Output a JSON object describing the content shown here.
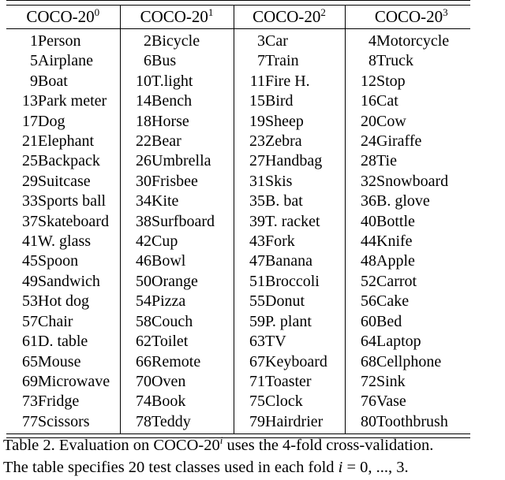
{
  "table": {
    "name": "coco-20i-class-split-table",
    "headers": [
      {
        "base": "COCO-20",
        "sup": "0"
      },
      {
        "base": "COCO-20",
        "sup": "1"
      },
      {
        "base": "COCO-20",
        "sup": "2"
      },
      {
        "base": "COCO-20",
        "sup": "3"
      }
    ],
    "rows": [
      [
        {
          "id": "1",
          "label": "Person"
        },
        {
          "id": "2",
          "label": "Bicycle"
        },
        {
          "id": "3",
          "label": "Car"
        },
        {
          "id": "4",
          "label": "Motorcycle"
        }
      ],
      [
        {
          "id": "5",
          "label": "Airplane"
        },
        {
          "id": "6",
          "label": "Bus"
        },
        {
          "id": "7",
          "label": "Train"
        },
        {
          "id": "8",
          "label": "Truck"
        }
      ],
      [
        {
          "id": "9",
          "label": "Boat"
        },
        {
          "id": "10",
          "label": "T.light"
        },
        {
          "id": "11",
          "label": "Fire H."
        },
        {
          "id": "12",
          "label": "Stop"
        }
      ],
      [
        {
          "id": "13",
          "label": "Park meter"
        },
        {
          "id": "14",
          "label": "Bench"
        },
        {
          "id": "15",
          "label": "Bird"
        },
        {
          "id": "16",
          "label": "Cat"
        }
      ],
      [
        {
          "id": "17",
          "label": "Dog"
        },
        {
          "id": "18",
          "label": "Horse"
        },
        {
          "id": "19",
          "label": "Sheep"
        },
        {
          "id": "20",
          "label": "Cow"
        }
      ],
      [
        {
          "id": "21",
          "label": "Elephant"
        },
        {
          "id": "22",
          "label": "Bear"
        },
        {
          "id": "23",
          "label": "Zebra"
        },
        {
          "id": "24",
          "label": "Giraffe"
        }
      ],
      [
        {
          "id": "25",
          "label": "Backpack"
        },
        {
          "id": "26",
          "label": "Umbrella"
        },
        {
          "id": "27",
          "label": "Handbag"
        },
        {
          "id": "28",
          "label": "Tie"
        }
      ],
      [
        {
          "id": "29",
          "label": "Suitcase"
        },
        {
          "id": "30",
          "label": "Frisbee"
        },
        {
          "id": "31",
          "label": "Skis"
        },
        {
          "id": "32",
          "label": "Snowboard"
        }
      ],
      [
        {
          "id": "33",
          "label": "Sports ball"
        },
        {
          "id": "34",
          "label": "Kite"
        },
        {
          "id": "35",
          "label": "B. bat"
        },
        {
          "id": "36",
          "label": "B. glove"
        }
      ],
      [
        {
          "id": "37",
          "label": "Skateboard"
        },
        {
          "id": "38",
          "label": "Surfboard"
        },
        {
          "id": "39",
          "label": "T. racket"
        },
        {
          "id": "40",
          "label": "Bottle"
        }
      ],
      [
        {
          "id": "41",
          "label": "W. glass"
        },
        {
          "id": "42",
          "label": "Cup"
        },
        {
          "id": "43",
          "label": "Fork"
        },
        {
          "id": "44",
          "label": "Knife"
        }
      ],
      [
        {
          "id": "45",
          "label": "Spoon"
        },
        {
          "id": "46",
          "label": "Bowl"
        },
        {
          "id": "47",
          "label": "Banana"
        },
        {
          "id": "48",
          "label": "Apple"
        }
      ],
      [
        {
          "id": "49",
          "label": "Sandwich"
        },
        {
          "id": "50",
          "label": "Orange"
        },
        {
          "id": "51",
          "label": "Broccoli"
        },
        {
          "id": "52",
          "label": "Carrot"
        }
      ],
      [
        {
          "id": "53",
          "label": "Hot dog"
        },
        {
          "id": "54",
          "label": "Pizza"
        },
        {
          "id": "55",
          "label": "Donut"
        },
        {
          "id": "56",
          "label": "Cake"
        }
      ],
      [
        {
          "id": "57",
          "label": "Chair"
        },
        {
          "id": "58",
          "label": "Couch"
        },
        {
          "id": "59",
          "label": "P. plant"
        },
        {
          "id": "60",
          "label": "Bed"
        }
      ],
      [
        {
          "id": "61",
          "label": "D. table"
        },
        {
          "id": "62",
          "label": "Toilet"
        },
        {
          "id": "63",
          "label": "TV"
        },
        {
          "id": "64",
          "label": "Laptop"
        }
      ],
      [
        {
          "id": "65",
          "label": "Mouse"
        },
        {
          "id": "66",
          "label": "Remote"
        },
        {
          "id": "67",
          "label": "Keyboard"
        },
        {
          "id": "68",
          "label": "Cellphone"
        }
      ],
      [
        {
          "id": "69",
          "label": "Microwave"
        },
        {
          "id": "70",
          "label": "Oven"
        },
        {
          "id": "71",
          "label": "Toaster"
        },
        {
          "id": "72",
          "label": "Sink"
        }
      ],
      [
        {
          "id": "73",
          "label": "Fridge"
        },
        {
          "id": "74",
          "label": "Book"
        },
        {
          "id": "75",
          "label": "Clock"
        },
        {
          "id": "76",
          "label": "Vase"
        }
      ],
      [
        {
          "id": "77",
          "label": "Scissors"
        },
        {
          "id": "78",
          "label": "Teddy"
        },
        {
          "id": "79",
          "label": "Hairdrier"
        },
        {
          "id": "80",
          "label": "Toothbrush"
        }
      ]
    ]
  },
  "caption": {
    "line1_a": "Table 2. Evaluation on COCO-20",
    "line1_sup": "i",
    "line1_b": " uses the 4-fold cross-validation.",
    "line2_a": "The table specifies 20 test classes used in each fold ",
    "line2_var": "i",
    "line2_b": " = 0, ..., 3."
  }
}
